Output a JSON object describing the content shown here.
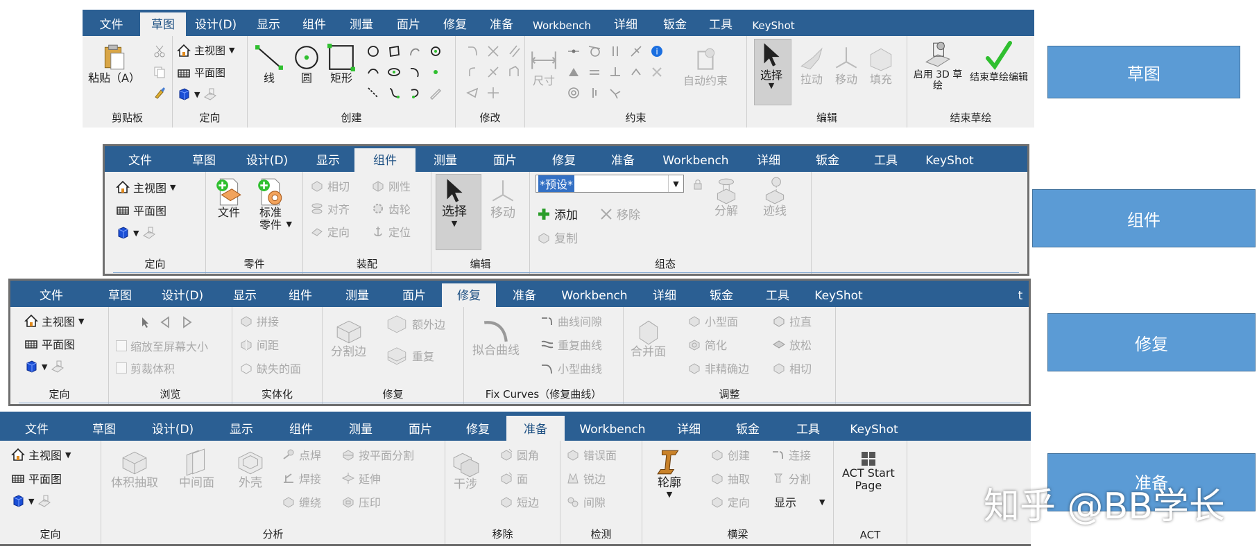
{
  "tabs": [
    "文件",
    "草图",
    "设计(D)",
    "显示",
    "组件",
    "测量",
    "面片",
    "修复",
    "准备",
    "Workbench",
    "详细",
    "钣金",
    "工具",
    "KeyShot"
  ],
  "tab_partial": "t",
  "colors": {
    "tabbar": "#2b5f93",
    "side_box": "#5b9bd5",
    "accent_check": "#2fbf2f",
    "icon_blue": "#1b4fd6"
  },
  "sketch": {
    "active_tab": "草图",
    "clipboard": {
      "paste": "粘贴（A）",
      "label": "剪贴板"
    },
    "orient": {
      "home": "主视图",
      "plan": "平面图",
      "label": "定向"
    },
    "create": {
      "line": "线",
      "circle": "圆",
      "rect": "矩形",
      "label": "创建"
    },
    "modify": {
      "label": "修改"
    },
    "constraints": {
      "dimension": "尺寸",
      "auto": "自动约束",
      "label": "约束"
    },
    "edit": {
      "select": "选择",
      "pull": "拉动",
      "move": "移动",
      "fill": "填充",
      "label": "编辑"
    },
    "end": {
      "enable3d": "启用 3D 草绘",
      "finish": "结束草绘编辑",
      "label": "结束草绘"
    }
  },
  "assembly": {
    "active_tab": "组件",
    "orient": {
      "home": "主视图",
      "plan": "平面图",
      "label": "定向"
    },
    "parts": {
      "file": "文件",
      "standard": "标准\n零件",
      "label": "零件"
    },
    "assemble": {
      "items": [
        "相切",
        "刚性",
        "对齐",
        "齿轮",
        "定向",
        "定位"
      ],
      "label": "装配"
    },
    "edit": {
      "select": "选择",
      "move": "移动",
      "label": "编辑"
    },
    "config": {
      "combo": "*预设*",
      "add": "添加",
      "remove": "移除",
      "copy": "复制",
      "explode": "分解",
      "trace": "迹线",
      "label": "组态"
    }
  },
  "repair": {
    "active_tab": "修复",
    "orient": {
      "home": "主视图",
      "plan": "平面图",
      "label": "定向"
    },
    "browse": {
      "zoom": "缩放至屏幕大小",
      "crop": "剪裁体积",
      "label": "浏览"
    },
    "solidify": {
      "stitch": "拼接",
      "gap": "间距",
      "missing": "缺失的面",
      "label": "实体化"
    },
    "fix": {
      "split": "分割边",
      "extra": "额外边",
      "dup": "重复",
      "label": "修复"
    },
    "curves": {
      "fit": "拟合曲线",
      "gap": "曲线间隙",
      "dup": "重复曲线",
      "small": "小型曲线",
      "label": "Fix Curves（修复曲线）"
    },
    "adjust": {
      "merge": "合并面",
      "small": "小型面",
      "simplify": "简化",
      "inexact": "非精确边",
      "straight": "拉直",
      "relax": "放松",
      "tangent": "相切",
      "label": "调整"
    }
  },
  "prepare": {
    "active_tab": "准备",
    "orient": {
      "home": "主视图",
      "plan": "平面图",
      "label": "定向"
    },
    "analysis": {
      "vol": "体积抽取",
      "mid": "中间面",
      "shell": "外壳",
      "spot": "点焊",
      "weld": "焊接",
      "wrap": "缠绕",
      "split": "按平面分割",
      "extend": "延伸",
      "imprint": "压印",
      "label": "分析"
    },
    "remove": {
      "interfere": "干涉",
      "round": "圆角",
      "face": "面",
      "short": "短边",
      "label": "移除"
    },
    "detect": {
      "err": "错误面",
      "sharp": "锐边",
      "gap": "间隙",
      "label": "检测"
    },
    "beam": {
      "profile": "轮廓",
      "create": "创建",
      "extract": "抽取",
      "orient": "定向",
      "connect": "连接",
      "split": "分割",
      "display": "显示",
      "label": "横梁"
    },
    "act": {
      "start": "ACT Start\nPage",
      "label": "ACT"
    }
  },
  "side_labels": [
    "草图",
    "组件",
    "修复",
    "准备"
  ],
  "watermark": "知乎 @BB学长"
}
